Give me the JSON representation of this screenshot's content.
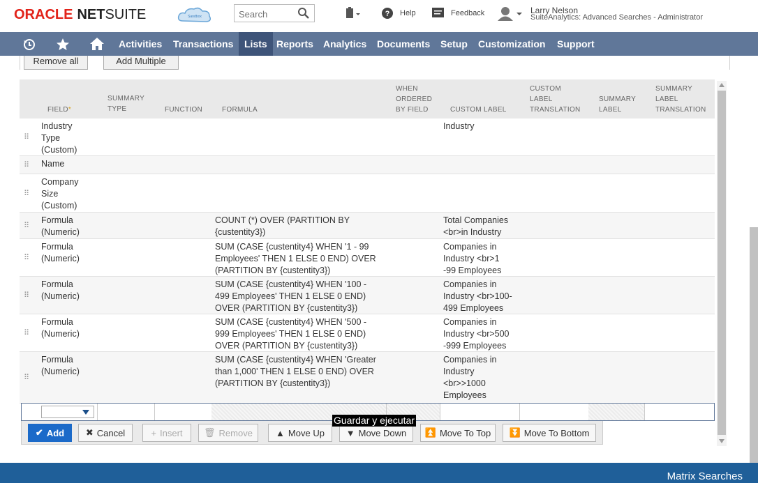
{
  "brand": {
    "oracle": "ORACLE",
    "net": "NET",
    "suite": "SUITE",
    "sandbox": "Sandbox"
  },
  "search": {
    "placeholder": "Search"
  },
  "header": {
    "help": "Help",
    "feedback": "Feedback",
    "user_name": "Larry Nelson",
    "user_role": "SuiteAnalytics: Advanced Searches - Administrator"
  },
  "nav": {
    "items": [
      "Activities",
      "Transactions",
      "Lists",
      "Reports",
      "Analytics",
      "Documents",
      "Setup",
      "Customization",
      "Support"
    ],
    "active": "Lists"
  },
  "top_buttons": {
    "remove_all": "Remove all",
    "add_multiple": "Add Multiple"
  },
  "columns": {
    "field": "FIELD",
    "summary_type": [
      "SUMMARY",
      "TYPE"
    ],
    "function": "FUNCTION",
    "formula": "FORMULA",
    "when_ordered": [
      "WHEN",
      "ORDERED",
      "BY FIELD"
    ],
    "custom_label": "CUSTOM LABEL",
    "custom_label_translation": [
      "CUSTOM",
      "LABEL",
      "TRANSLATION"
    ],
    "summary_label": [
      "SUMMARY",
      "LABEL"
    ],
    "summary_label_translation": [
      "SUMMARY",
      "LABEL",
      "TRANSLATION"
    ]
  },
  "rows": [
    {
      "field": [
        "Industry",
        "Type",
        "(Custom)"
      ],
      "formula": [],
      "label": [
        "Industry"
      ]
    },
    {
      "field": [
        "Name"
      ],
      "formula": [],
      "label": []
    },
    {
      "field": [
        "Company",
        "Size",
        "(Custom)"
      ],
      "formula": [],
      "label": []
    },
    {
      "field": [
        "Formula",
        "(Numeric)"
      ],
      "formula": [
        "COUNT (*) OVER (PARTITION BY",
        "{custentity3})"
      ],
      "label": [
        "Total Companies",
        "<br>in Industry"
      ]
    },
    {
      "field": [
        "Formula",
        "(Numeric)"
      ],
      "formula": [
        "SUM (CASE {custentity4} WHEN '1 - 99",
        "Employees' THEN 1 ELSE 0 END) OVER",
        "(PARTITION BY {custentity3})"
      ],
      "label": [
        "Companies in",
        "Industry <br>1",
        "-99 Employees"
      ]
    },
    {
      "field": [
        "Formula",
        "(Numeric)"
      ],
      "formula": [
        "SUM (CASE {custentity4} WHEN '100 -",
        "499 Employees' THEN 1 ELSE 0 END)",
        "OVER (PARTITION BY {custentity3})"
      ],
      "label": [
        "Companies in",
        "Industry <br>100-",
        "499 Employees"
      ]
    },
    {
      "field": [
        "Formula",
        "(Numeric)"
      ],
      "formula": [
        "SUM (CASE {custentity4} WHEN '500 -",
        "999 Employees' THEN 1 ELSE 0 END)",
        "OVER (PARTITION BY {custentity3})"
      ],
      "label": [
        "Companies in",
        "Industry <br>500",
        "-999 Employees"
      ]
    },
    {
      "field": [
        "Formula",
        "(Numeric)"
      ],
      "formula": [
        "SUM (CASE {custentity4} WHEN 'Greater",
        "than 1,000' THEN 1 ELSE 0 END) OVER",
        "(PARTITION BY {custentity3})"
      ],
      "label": [
        "Companies in",
        "Industry",
        "<br>>1000",
        "Employees"
      ]
    }
  ],
  "actions": {
    "add": "Add",
    "cancel": "Cancel",
    "insert": "Insert",
    "remove": "Remove",
    "move_up": "Move Up",
    "move_down": "Move Down",
    "move_to_top": "Move To Top",
    "move_to_bottom": "Move To Bottom"
  },
  "tooltip": "Guardar y ejecutar",
  "footer": "Matrix Searches"
}
